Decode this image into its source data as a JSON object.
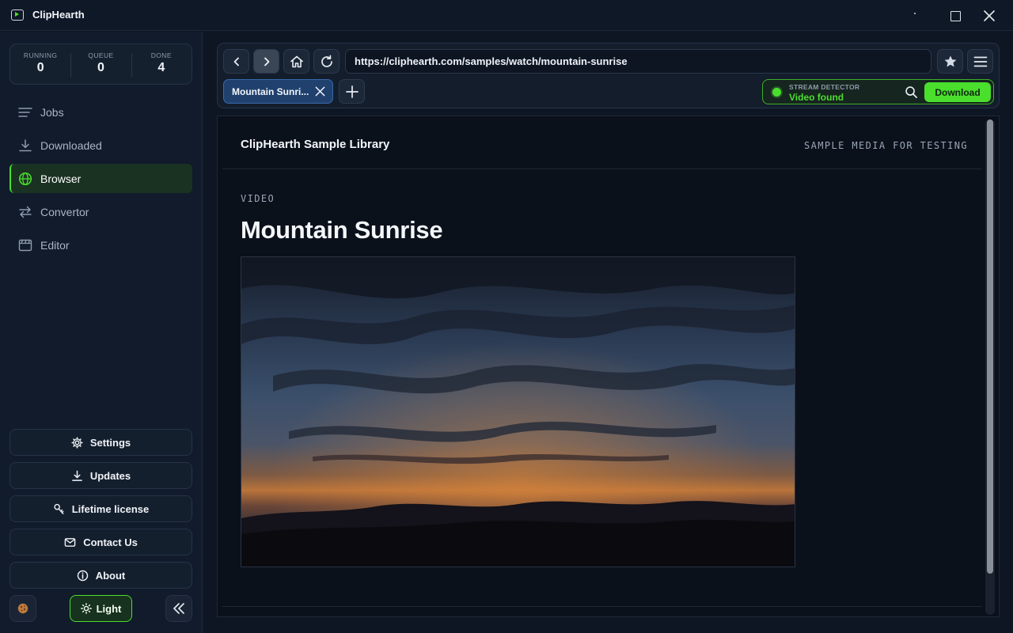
{
  "app": {
    "title": "ClipHearth"
  },
  "stats": [
    {
      "label": "RUNNING",
      "value": "0"
    },
    {
      "label": "QUEUE",
      "value": "0"
    },
    {
      "label": "DONE",
      "value": "4"
    }
  ],
  "nav": [
    {
      "label": "Jobs",
      "icon": "list-icon"
    },
    {
      "label": "Downloaded",
      "icon": "download-icon"
    },
    {
      "label": "Browser",
      "icon": "globe-icon",
      "active": true
    },
    {
      "label": "Convertor",
      "icon": "swap-arrows-icon"
    },
    {
      "label": "Editor",
      "icon": "clapperboard-icon"
    }
  ],
  "sidebar_buttons": {
    "settings": "Settings",
    "updates": "Updates",
    "license": "Lifetime license",
    "contact": "Contact Us",
    "about": "About"
  },
  "theme_toggle": "Light",
  "browser": {
    "url": "https://cliphearth.com/samples/watch/mountain-sunrise",
    "tab_title": "Mountain Sunri...",
    "detector_label": "STREAM DETECTOR",
    "detector_status": "Video found",
    "download_label": "Download"
  },
  "page": {
    "site_name": "ClipHearth Sample Library",
    "tagline": "SAMPLE MEDIA FOR TESTING",
    "kicker": "VIDEO",
    "video_title": "Mountain Sunrise"
  },
  "colors": {
    "accent": "#4ade2d",
    "tab_active": "#20416e",
    "background": "#0e1624"
  }
}
